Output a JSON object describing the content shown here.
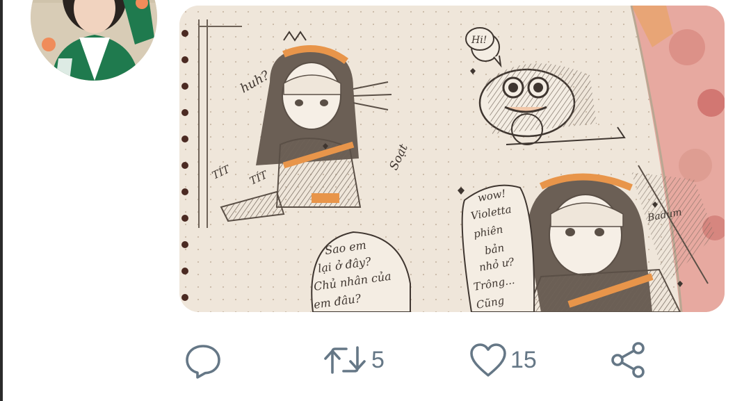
{
  "tweet": {
    "media": {
      "sketch_texts": {
        "sfx_huh": "huh?",
        "sfx_tit1": "TÍT",
        "sfx_tit2": "TÍT",
        "sfx_soat": "Soạt",
        "bubble_hi": "Hi!",
        "bubble_left": [
          "Sao em",
          "lại ở đây?",
          "Chủ nhân của",
          "em đâu?"
        ],
        "bubble_right": [
          "wow!",
          "Violetta",
          "phiên",
          "bản",
          "nhỏ ư?",
          "Trông...",
          "Cũng"
        ],
        "sign": "Badum"
      }
    },
    "actions": {
      "reply": {
        "icon": "reply-bubble-icon"
      },
      "retweet": {
        "icon": "retweet-icon",
        "count": "5"
      },
      "like": {
        "icon": "heart-icon",
        "count": "15"
      },
      "share": {
        "icon": "share-icon"
      }
    },
    "colors": {
      "icon_gray": "#657786",
      "sketch_orange": "#e8954a",
      "paper": "#efe6da"
    }
  }
}
